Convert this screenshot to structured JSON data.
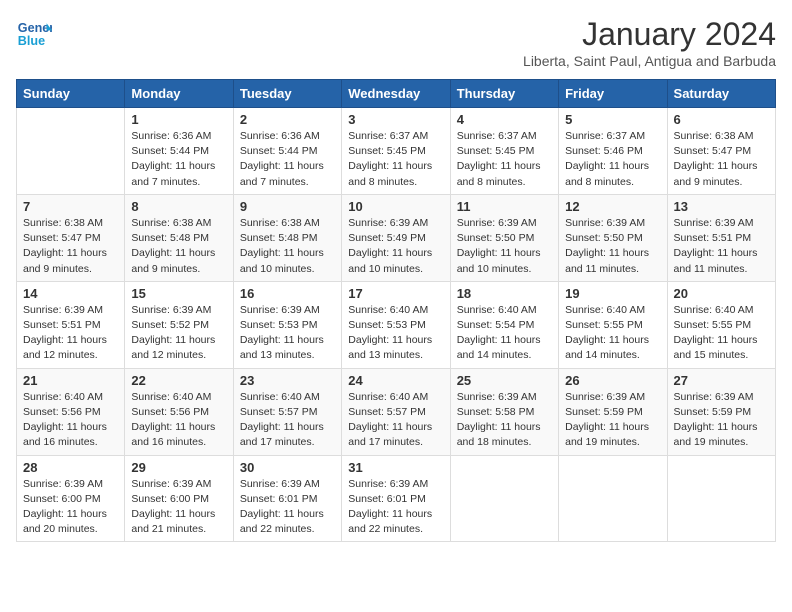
{
  "logo": {
    "line1": "General",
    "line2": "Blue"
  },
  "title": "January 2024",
  "location": "Liberta, Saint Paul, Antigua and Barbuda",
  "weekdays": [
    "Sunday",
    "Monday",
    "Tuesday",
    "Wednesday",
    "Thursday",
    "Friday",
    "Saturday"
  ],
  "weeks": [
    [
      {
        "day": "",
        "sunrise": "",
        "sunset": "",
        "daylight": ""
      },
      {
        "day": "1",
        "sunrise": "Sunrise: 6:36 AM",
        "sunset": "Sunset: 5:44 PM",
        "daylight": "Daylight: 11 hours and 7 minutes."
      },
      {
        "day": "2",
        "sunrise": "Sunrise: 6:36 AM",
        "sunset": "Sunset: 5:44 PM",
        "daylight": "Daylight: 11 hours and 7 minutes."
      },
      {
        "day": "3",
        "sunrise": "Sunrise: 6:37 AM",
        "sunset": "Sunset: 5:45 PM",
        "daylight": "Daylight: 11 hours and 8 minutes."
      },
      {
        "day": "4",
        "sunrise": "Sunrise: 6:37 AM",
        "sunset": "Sunset: 5:45 PM",
        "daylight": "Daylight: 11 hours and 8 minutes."
      },
      {
        "day": "5",
        "sunrise": "Sunrise: 6:37 AM",
        "sunset": "Sunset: 5:46 PM",
        "daylight": "Daylight: 11 hours and 8 minutes."
      },
      {
        "day": "6",
        "sunrise": "Sunrise: 6:38 AM",
        "sunset": "Sunset: 5:47 PM",
        "daylight": "Daylight: 11 hours and 9 minutes."
      }
    ],
    [
      {
        "day": "7",
        "sunrise": "Sunrise: 6:38 AM",
        "sunset": "Sunset: 5:47 PM",
        "daylight": "Daylight: 11 hours and 9 minutes."
      },
      {
        "day": "8",
        "sunrise": "Sunrise: 6:38 AM",
        "sunset": "Sunset: 5:48 PM",
        "daylight": "Daylight: 11 hours and 9 minutes."
      },
      {
        "day": "9",
        "sunrise": "Sunrise: 6:38 AM",
        "sunset": "Sunset: 5:48 PM",
        "daylight": "Daylight: 11 hours and 10 minutes."
      },
      {
        "day": "10",
        "sunrise": "Sunrise: 6:39 AM",
        "sunset": "Sunset: 5:49 PM",
        "daylight": "Daylight: 11 hours and 10 minutes."
      },
      {
        "day": "11",
        "sunrise": "Sunrise: 6:39 AM",
        "sunset": "Sunset: 5:50 PM",
        "daylight": "Daylight: 11 hours and 10 minutes."
      },
      {
        "day": "12",
        "sunrise": "Sunrise: 6:39 AM",
        "sunset": "Sunset: 5:50 PM",
        "daylight": "Daylight: 11 hours and 11 minutes."
      },
      {
        "day": "13",
        "sunrise": "Sunrise: 6:39 AM",
        "sunset": "Sunset: 5:51 PM",
        "daylight": "Daylight: 11 hours and 11 minutes."
      }
    ],
    [
      {
        "day": "14",
        "sunrise": "Sunrise: 6:39 AM",
        "sunset": "Sunset: 5:51 PM",
        "daylight": "Daylight: 11 hours and 12 minutes."
      },
      {
        "day": "15",
        "sunrise": "Sunrise: 6:39 AM",
        "sunset": "Sunset: 5:52 PM",
        "daylight": "Daylight: 11 hours and 12 minutes."
      },
      {
        "day": "16",
        "sunrise": "Sunrise: 6:39 AM",
        "sunset": "Sunset: 5:53 PM",
        "daylight": "Daylight: 11 hours and 13 minutes."
      },
      {
        "day": "17",
        "sunrise": "Sunrise: 6:40 AM",
        "sunset": "Sunset: 5:53 PM",
        "daylight": "Daylight: 11 hours and 13 minutes."
      },
      {
        "day": "18",
        "sunrise": "Sunrise: 6:40 AM",
        "sunset": "Sunset: 5:54 PM",
        "daylight": "Daylight: 11 hours and 14 minutes."
      },
      {
        "day": "19",
        "sunrise": "Sunrise: 6:40 AM",
        "sunset": "Sunset: 5:55 PM",
        "daylight": "Daylight: 11 hours and 14 minutes."
      },
      {
        "day": "20",
        "sunrise": "Sunrise: 6:40 AM",
        "sunset": "Sunset: 5:55 PM",
        "daylight": "Daylight: 11 hours and 15 minutes."
      }
    ],
    [
      {
        "day": "21",
        "sunrise": "Sunrise: 6:40 AM",
        "sunset": "Sunset: 5:56 PM",
        "daylight": "Daylight: 11 hours and 16 minutes."
      },
      {
        "day": "22",
        "sunrise": "Sunrise: 6:40 AM",
        "sunset": "Sunset: 5:56 PM",
        "daylight": "Daylight: 11 hours and 16 minutes."
      },
      {
        "day": "23",
        "sunrise": "Sunrise: 6:40 AM",
        "sunset": "Sunset: 5:57 PM",
        "daylight": "Daylight: 11 hours and 17 minutes."
      },
      {
        "day": "24",
        "sunrise": "Sunrise: 6:40 AM",
        "sunset": "Sunset: 5:57 PM",
        "daylight": "Daylight: 11 hours and 17 minutes."
      },
      {
        "day": "25",
        "sunrise": "Sunrise: 6:39 AM",
        "sunset": "Sunset: 5:58 PM",
        "daylight": "Daylight: 11 hours and 18 minutes."
      },
      {
        "day": "26",
        "sunrise": "Sunrise: 6:39 AM",
        "sunset": "Sunset: 5:59 PM",
        "daylight": "Daylight: 11 hours and 19 minutes."
      },
      {
        "day": "27",
        "sunrise": "Sunrise: 6:39 AM",
        "sunset": "Sunset: 5:59 PM",
        "daylight": "Daylight: 11 hours and 19 minutes."
      }
    ],
    [
      {
        "day": "28",
        "sunrise": "Sunrise: 6:39 AM",
        "sunset": "Sunset: 6:00 PM",
        "daylight": "Daylight: 11 hours and 20 minutes."
      },
      {
        "day": "29",
        "sunrise": "Sunrise: 6:39 AM",
        "sunset": "Sunset: 6:00 PM",
        "daylight": "Daylight: 11 hours and 21 minutes."
      },
      {
        "day": "30",
        "sunrise": "Sunrise: 6:39 AM",
        "sunset": "Sunset: 6:01 PM",
        "daylight": "Daylight: 11 hours and 22 minutes."
      },
      {
        "day": "31",
        "sunrise": "Sunrise: 6:39 AM",
        "sunset": "Sunset: 6:01 PM",
        "daylight": "Daylight: 11 hours and 22 minutes."
      },
      {
        "day": "",
        "sunrise": "",
        "sunset": "",
        "daylight": ""
      },
      {
        "day": "",
        "sunrise": "",
        "sunset": "",
        "daylight": ""
      },
      {
        "day": "",
        "sunrise": "",
        "sunset": "",
        "daylight": ""
      }
    ]
  ]
}
